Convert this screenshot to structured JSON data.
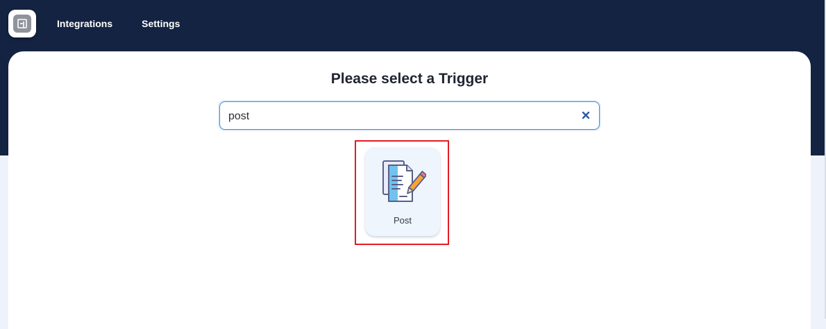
{
  "nav": {
    "items": [
      {
        "label": "Integrations"
      },
      {
        "label": "Settings"
      }
    ]
  },
  "page": {
    "title": "Please select a Trigger"
  },
  "search": {
    "value": "post"
  },
  "results": [
    {
      "label": "Post",
      "icon": "document-edit-icon"
    }
  ],
  "colors": {
    "header_bg": "#132341",
    "highlight": "#e31b23",
    "search_border": "#3a86d8",
    "card_bg": "#eef5fd"
  }
}
